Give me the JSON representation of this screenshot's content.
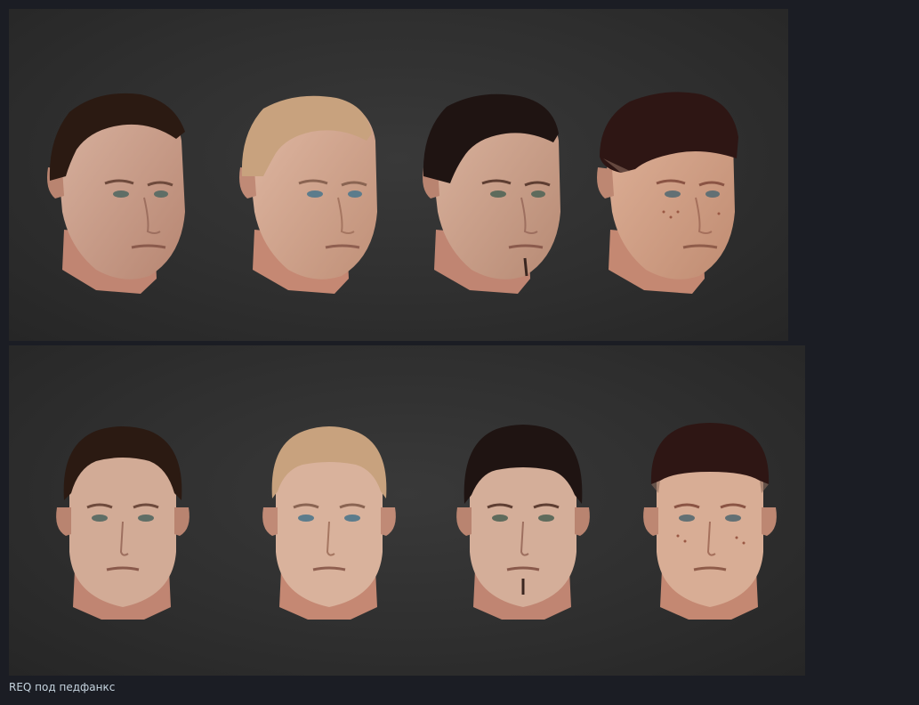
{
  "caption": "REQ под педфанкс",
  "images": [
    {
      "view": "three-quarter",
      "heads": [
        {
          "hair": "dark-brown-slicked",
          "hair_color": "#2b1a12",
          "skin": "#c49a82"
        },
        {
          "hair": "blond-buzz",
          "hair_color": "#c8a27e",
          "skin": "#d3a88f"
        },
        {
          "hair": "black-short",
          "hair_color": "#1f1412",
          "skin": "#c79d86"
        },
        {
          "hair": "dark-fade",
          "hair_color": "#2e1614",
          "skin": "#d1a48b"
        }
      ]
    },
    {
      "view": "front",
      "heads": [
        {
          "hair": "dark-brown-slicked",
          "hair_color": "#2b1a12",
          "skin": "#c49a82"
        },
        {
          "hair": "blond-buzz",
          "hair_color": "#c8a27e",
          "skin": "#d3a88f"
        },
        {
          "hair": "black-short",
          "hair_color": "#1f1412",
          "skin": "#c79d86"
        },
        {
          "hair": "dark-fade",
          "hair_color": "#2e1614",
          "skin": "#d1a48b"
        }
      ]
    }
  ]
}
